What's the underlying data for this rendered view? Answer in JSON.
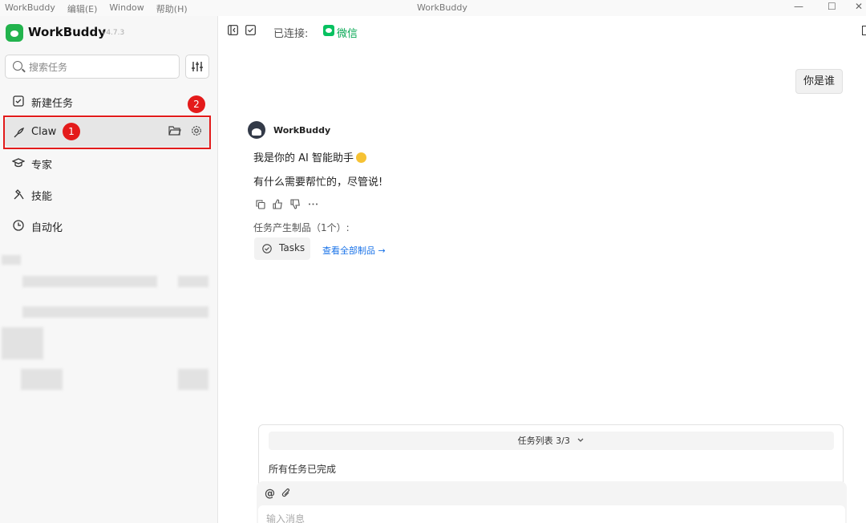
{
  "window": {
    "title": "WorkBuddy",
    "menu": [
      "WorkBuddy",
      "编辑(E)",
      "Window",
      "帮助(H)"
    ],
    "controls": {
      "minimize": "—",
      "maximize": "☐",
      "close": "✕"
    }
  },
  "sidebar": {
    "app_name": "WorkBuddy",
    "version": "v4.7.3",
    "search_placeholder": "搜索任务",
    "nav": [
      {
        "label": "新建任务",
        "icon": "new-task-icon"
      },
      {
        "label": "Claw",
        "icon": "claw-icon"
      },
      {
        "label": "专家",
        "icon": "expert-icon"
      },
      {
        "label": "技能",
        "icon": "skills-icon"
      },
      {
        "label": "自动化",
        "icon": "clock-icon"
      }
    ],
    "annotations": [
      "1",
      "2"
    ]
  },
  "main": {
    "connected_label": "已连接:",
    "wechat_label": "微信",
    "user_message": "你是谁",
    "bot_name": "WorkBuddy",
    "bot_lines": [
      "我是你的 AI 智能助手",
      "有什么需要帮忙的，尽管说!"
    ],
    "artifacts_label": "任务产生制品（1个）:",
    "artifact_chip": "Tasks",
    "view_all": "查看全部制品 →",
    "task_list_header": "任务列表 3/3",
    "task_status": "所有任务已完成",
    "at_label": "@",
    "input_placeholder": "输入消息"
  },
  "colors": {
    "accent_green": "#22b34d",
    "wechat_green": "#07c160",
    "annotation_red": "#e21b1b",
    "link_blue": "#1a73e8"
  }
}
